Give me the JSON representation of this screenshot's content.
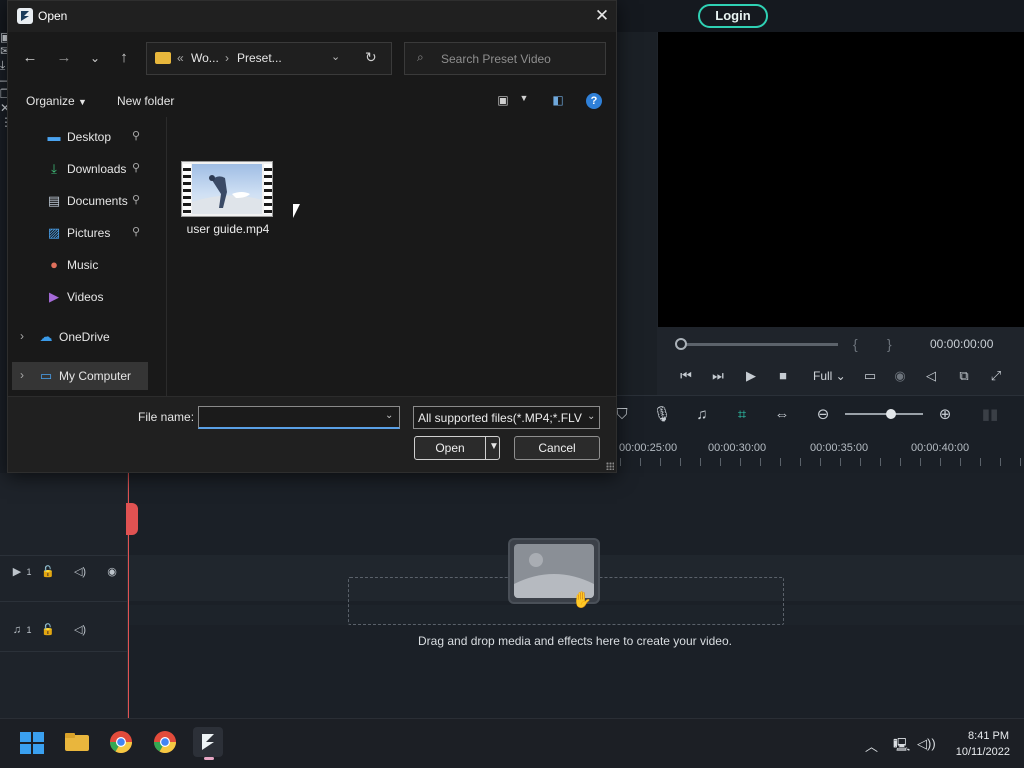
{
  "app": {
    "login_label": "Login",
    "preview": {
      "timecode": "00:00:00:00",
      "mark_in": "{",
      "mark_out": "}",
      "zoom_label": "Full"
    },
    "ruler_labels": [
      "00:00:25:00",
      "00:00:30:00",
      "00:00:35:00",
      "00:00:40:00"
    ],
    "tracks": {
      "video_index": "1",
      "audio_index": "1"
    },
    "drop_hint": "Drag and drop media and effects here to create your video.",
    "accent_color": "#2fd1b4",
    "playhead_color": "#e05252"
  },
  "dialog": {
    "title": "Open",
    "breadcrumb": {
      "overflow": "«",
      "parent": "Wo...",
      "separator": "›",
      "current": "Preset..."
    },
    "search_placeholder": "Search Preset Video",
    "commands": {
      "organize": "Organize",
      "new_folder": "New folder",
      "help": "?"
    },
    "nav_items": [
      {
        "label": "Desktop",
        "icon": "desktop-icon",
        "pinned": true
      },
      {
        "label": "Downloads",
        "icon": "downloads-icon",
        "pinned": true
      },
      {
        "label": "Documents",
        "icon": "documents-icon",
        "pinned": true
      },
      {
        "label": "Pictures",
        "icon": "pictures-icon",
        "pinned": true
      },
      {
        "label": "Music",
        "icon": "music-icon",
        "pinned": false
      },
      {
        "label": "Videos",
        "icon": "videos-icon",
        "pinned": false
      },
      {
        "label": "OneDrive",
        "icon": "onedrive-icon",
        "pinned": false
      },
      {
        "label": "My Computer",
        "icon": "computer-icon",
        "pinned": false,
        "selected": true
      }
    ],
    "files": [
      {
        "name": "user guide.mp4",
        "type": "video"
      }
    ],
    "file_name_label": "File name:",
    "file_name_value": "",
    "file_type_filter": "All supported files(*.MP4;*.FLV;",
    "open_label": "Open",
    "cancel_label": "Cancel"
  },
  "taskbar": {
    "time": "8:41 PM",
    "date": "10/11/2022"
  }
}
